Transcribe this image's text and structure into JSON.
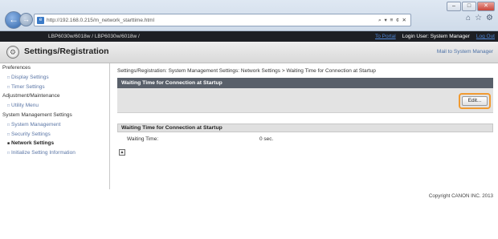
{
  "browser": {
    "url": "http://192.168.0.215/m_network_starttime.html",
    "addr_tools": "⌕ ▾ ≡ ¢ ✕",
    "window_controls": [
      "–",
      "□",
      "✕"
    ]
  },
  "header": {
    "device_name": "LBP6030w/6018w / LBP6030w/6018w /",
    "portal_link": "To Portal",
    "login_user": "Login User: System Manager",
    "logout_link": "Log Out"
  },
  "title": {
    "text": "Settings/Registration",
    "mail_link": "Mail to System Manager"
  },
  "sidebar": {
    "items": [
      {
        "label": "Preferences",
        "level": "top"
      },
      {
        "label": "Display Settings",
        "level": "sub"
      },
      {
        "label": "Timer Settings",
        "level": "sub"
      },
      {
        "label": "Adjustment/Maintenance",
        "level": "top"
      },
      {
        "label": "Utility Menu",
        "level": "sub"
      },
      {
        "label": "System Management Settings",
        "level": "top"
      },
      {
        "label": "System Management",
        "level": "sub"
      },
      {
        "label": "Security Settings",
        "level": "sub"
      },
      {
        "label": "Network Settings",
        "level": "sub",
        "active": true
      },
      {
        "label": "Initialize Setting Information",
        "level": "sub"
      }
    ]
  },
  "main": {
    "breadcrumb": "Settings/Registration: System Management Settings: Network Settings > Waiting Time for Connection at Startup",
    "section_title": "Waiting Time for Connection at Startup",
    "edit_label": "Edit...",
    "subsection_title": "Waiting Time for Connection at Startup",
    "field_label": "Waiting Time:",
    "field_value": "0 sec."
  },
  "footer": {
    "copyright": "Copyright CANON INC. 2013"
  },
  "colors": {
    "section_bar": "#59606a",
    "highlight": "#f19a30",
    "link": "#5b76a6",
    "header_bg": "#1d1f24"
  }
}
